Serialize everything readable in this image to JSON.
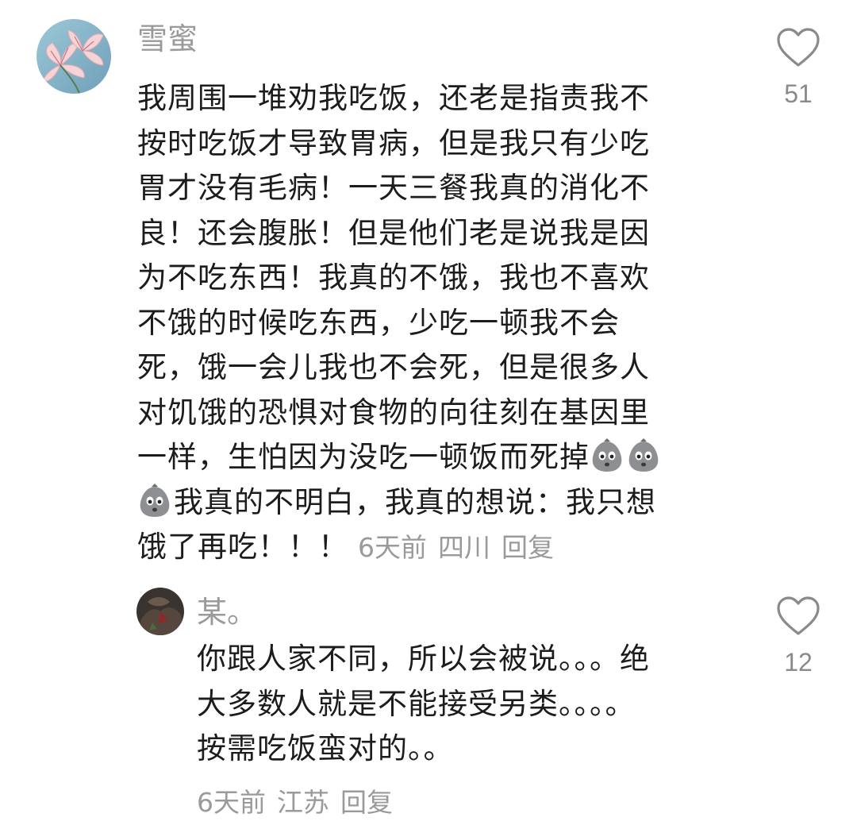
{
  "comments": [
    {
      "username": "雪蜜",
      "lines": [
        "我周围一堆劝我吃饭，还老是指责我不",
        "按时吃饭才导致胃病，但是我只有少吃",
        "胃才没有毛病！一天三餐我真的消化不",
        "良！还会腹胀！但是他们老是说我是因",
        "为不吃东西！我真的不饿，我也不喜欢",
        "不饿的时候吃东西，少吃一顿我不会",
        "死，饿一会儿我也不会死，但是很多人",
        "对饥饿的恐惧对食物的向往刻在基因里",
        "一样，生怕因为没吃一顿饭而死掉",
        "我真的不明白，我真的想说：我只想",
        "饿了再吃！！！"
      ],
      "emoji_icon": "worried-potato-emoji",
      "time": "6天前",
      "location": "四川",
      "reply_label": "回复",
      "like_count": "51"
    },
    {
      "username": "某。",
      "lines": [
        "你跟人家不同，所以会被说。。。绝",
        "大多数人就是不能接受另类。。。。",
        "按需吃饭蛮对的。。"
      ],
      "time": "6天前",
      "location": "江苏",
      "reply_label": "回复",
      "like_count": "12"
    }
  ],
  "icons": {
    "like": "heart-outline-icon"
  },
  "colors": {
    "meta_text": "#9a9a9a",
    "body_text": "#1c1c1c"
  }
}
